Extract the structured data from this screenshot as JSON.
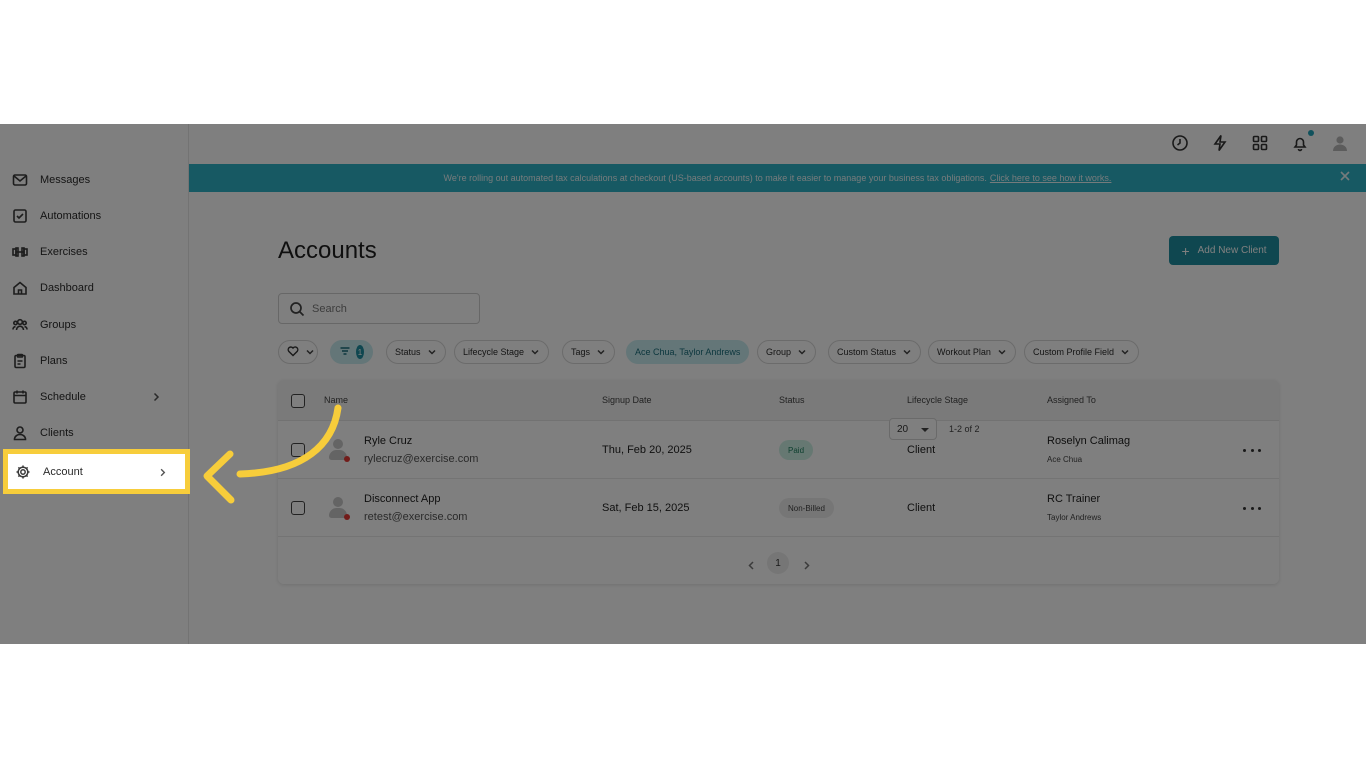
{
  "sidebar": {
    "items": [
      {
        "label": "Messages",
        "icon": "mail-icon"
      },
      {
        "label": "Automations",
        "icon": "check-square-icon"
      },
      {
        "label": "Exercises",
        "icon": "dumbbell-icon"
      },
      {
        "label": "Dashboard",
        "icon": "home-icon"
      },
      {
        "label": "Groups",
        "icon": "users-icon"
      },
      {
        "label": "Plans",
        "icon": "clipboard-icon"
      },
      {
        "label": "Schedule",
        "icon": "calendar-icon"
      },
      {
        "label": "Clients",
        "icon": "user-icon"
      },
      {
        "label": "Account",
        "icon": "gear-icon"
      }
    ]
  },
  "topbar": {
    "icons": [
      "clock-icon",
      "lightning-icon",
      "apps-grid-icon",
      "bell-icon",
      "profile-avatar-icon"
    ],
    "notification_color": "#21a3b8"
  },
  "banner": {
    "text": "We're rolling out automated tax calculations at checkout (US-based accounts) to make it easier to manage your business tax obligations.",
    "link": "Click here to see how it works.",
    "color": "#2fb2c6"
  },
  "main": {
    "title": "Accounts",
    "add_button": "Add New Client",
    "search_placeholder": "Search",
    "filters": {
      "filter_count": "1",
      "chips": [
        "Status",
        "Lifecycle Stage",
        "Tags",
        "Ace Chua, Taylor Andrews",
        "Group",
        "Custom Status",
        "Workout Plan",
        "Custom Profile Field"
      ]
    },
    "table": {
      "columns": [
        "Name",
        "Signup Date",
        "Status",
        "Lifecycle Stage",
        "Assigned To"
      ],
      "rows": [
        {
          "name": "Ryle Cruz",
          "email": "rylecruz@exercise.com",
          "signup": "Thu, Feb 20, 2025",
          "status": "Paid",
          "stage": "Client",
          "assigned": "Roselyn Calimag",
          "assigned_sub": "Ace Chua"
        },
        {
          "name": "Disconnect App",
          "email": "retest@exercise.com",
          "signup": "Sat, Feb 15, 2025",
          "status": "Non-Billed",
          "stage": "Client",
          "assigned": "RC Trainer",
          "assigned_sub": "Taylor Andrews"
        }
      ]
    },
    "pagination": {
      "page": "1",
      "per_page": "20",
      "range": "1-2 of 2"
    }
  },
  "accent_color": "#1f8fa0",
  "highlight_color": "#f7cd3b"
}
